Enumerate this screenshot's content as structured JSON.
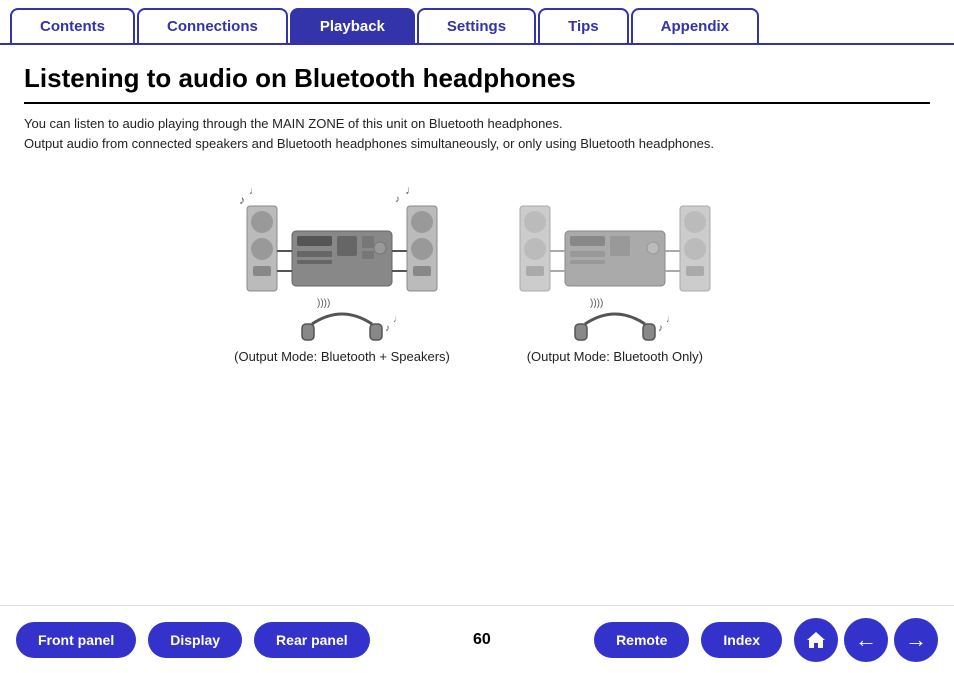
{
  "tabs": [
    {
      "id": "contents",
      "label": "Contents",
      "active": false
    },
    {
      "id": "connections",
      "label": "Connections",
      "active": false
    },
    {
      "id": "playback",
      "label": "Playback",
      "active": true
    },
    {
      "id": "settings",
      "label": "Settings",
      "active": false
    },
    {
      "id": "tips",
      "label": "Tips",
      "active": false
    },
    {
      "id": "appendix",
      "label": "Appendix",
      "active": false
    }
  ],
  "page": {
    "title": "Listening to audio on Bluetooth headphones",
    "description_line1": "You can listen to audio playing through the MAIN ZONE of this unit on Bluetooth headphones.",
    "description_line2": "Output audio from connected speakers and Bluetooth headphones simultaneously, or only using Bluetooth headphones."
  },
  "diagrams": [
    {
      "id": "diagram-left",
      "caption": "(Output Mode: Bluetooth + Speakers)"
    },
    {
      "id": "diagram-right",
      "caption": "(Output Mode: Bluetooth Only)"
    }
  ],
  "page_number": "60",
  "bottom_nav": {
    "front_panel": "Front panel",
    "display": "Display",
    "rear_panel": "Rear panel",
    "remote": "Remote",
    "index": "Index"
  }
}
